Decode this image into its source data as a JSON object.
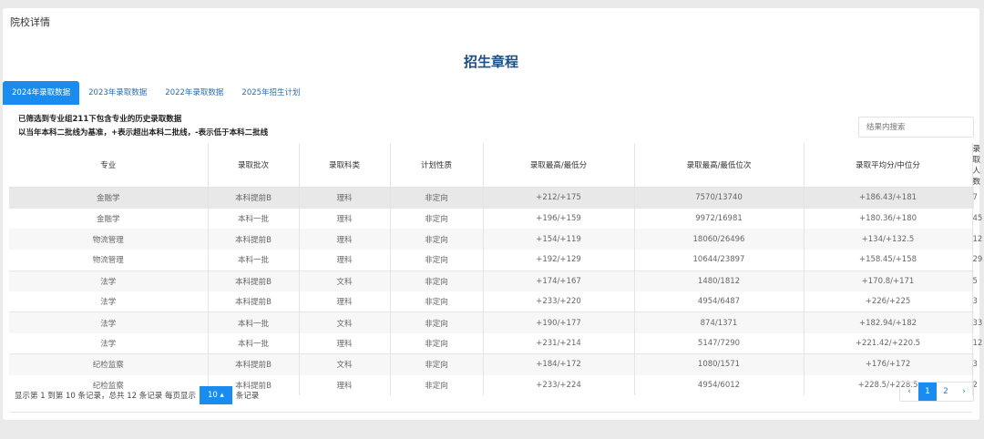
{
  "header": "院校详情",
  "title": "招生章程",
  "tabs": [
    "2024年录取数据",
    "2023年录取数据",
    "2022年录取数据",
    "2025年招生计划"
  ],
  "notes": [
    "已筛选到专业组211下包含专业的历史录取数据",
    "以当年本科二批线为基准，+表示超出本科二批线，-表示低于本科二批线"
  ],
  "search_placeholder": "结果内搜索",
  "columns": [
    "专业",
    "录取批次",
    "录取科类",
    "计划性质",
    "录取最高/最低分",
    "录取最高/最低位次",
    "录取平均分/中位分",
    "录取人数"
  ],
  "rows": [
    [
      "金融学",
      "本科提前B",
      "理科",
      "非定向",
      "+212/+175",
      "7570/13740",
      "+186.43/+181",
      "7"
    ],
    [
      "金融学",
      "本科一批",
      "理科",
      "非定向",
      "+196/+159",
      "9972/16981",
      "+180.36/+180",
      "45"
    ],
    [
      "物流管理",
      "本科提前B",
      "理科",
      "非定向",
      "+154/+119",
      "18060/26496",
      "+134/+132.5",
      "12"
    ],
    [
      "物流管理",
      "本科一批",
      "理科",
      "非定向",
      "+192/+129",
      "10644/23897",
      "+158.45/+158",
      "29"
    ],
    [
      "法学",
      "本科提前B",
      "文科",
      "非定向",
      "+174/+167",
      "1480/1812",
      "+170.8/+171",
      "5"
    ],
    [
      "法学",
      "本科提前B",
      "理科",
      "非定向",
      "+233/+220",
      "4954/6487",
      "+226/+225",
      "3"
    ],
    [
      "法学",
      "本科一批",
      "文科",
      "非定向",
      "+190/+177",
      "874/1371",
      "+182.94/+182",
      "33"
    ],
    [
      "法学",
      "本科一批",
      "理科",
      "非定向",
      "+231/+214",
      "5147/7290",
      "+221.42/+220.5",
      "12"
    ],
    [
      "纪检监察",
      "本科提前B",
      "文科",
      "非定向",
      "+184/+172",
      "1080/1571",
      "+176/+172",
      "3"
    ],
    [
      "纪检监察",
      "本科提前B",
      "理科",
      "非定向",
      "+233/+224",
      "4954/6012",
      "+228.5/+228.5",
      "2"
    ]
  ],
  "footer": {
    "summary": "显示第 1 到第 10 条记录，总共 12 条记录 每页显示",
    "page_size": "10 ▴",
    "suffix": "条记录"
  },
  "pager": {
    "prev": "‹",
    "pages": [
      "1",
      "2"
    ],
    "next": "›"
  }
}
